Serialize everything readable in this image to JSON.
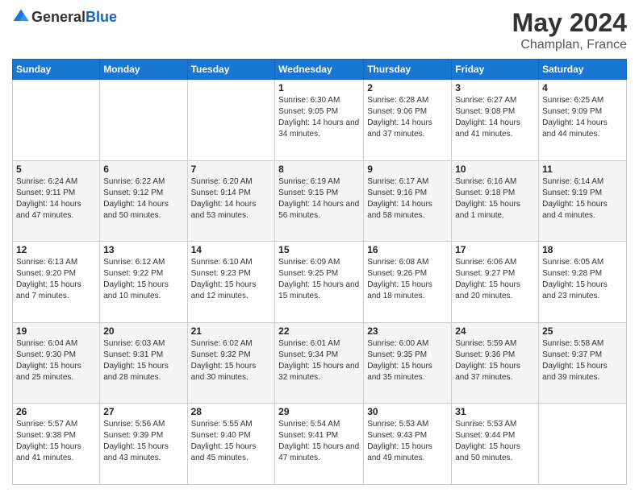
{
  "header": {
    "logo_general": "General",
    "logo_blue": "Blue",
    "month_year": "May 2024",
    "location": "Champlan, France"
  },
  "days_of_week": [
    "Sunday",
    "Monday",
    "Tuesday",
    "Wednesday",
    "Thursday",
    "Friday",
    "Saturday"
  ],
  "weeks": [
    [
      {
        "day": "",
        "sunrise": "",
        "sunset": "",
        "daylight": ""
      },
      {
        "day": "",
        "sunrise": "",
        "sunset": "",
        "daylight": ""
      },
      {
        "day": "",
        "sunrise": "",
        "sunset": "",
        "daylight": ""
      },
      {
        "day": "1",
        "sunrise": "Sunrise: 6:30 AM",
        "sunset": "Sunset: 9:05 PM",
        "daylight": "Daylight: 14 hours and 34 minutes."
      },
      {
        "day": "2",
        "sunrise": "Sunrise: 6:28 AM",
        "sunset": "Sunset: 9:06 PM",
        "daylight": "Daylight: 14 hours and 37 minutes."
      },
      {
        "day": "3",
        "sunrise": "Sunrise: 6:27 AM",
        "sunset": "Sunset: 9:08 PM",
        "daylight": "Daylight: 14 hours and 41 minutes."
      },
      {
        "day": "4",
        "sunrise": "Sunrise: 6:25 AM",
        "sunset": "Sunset: 9:09 PM",
        "daylight": "Daylight: 14 hours and 44 minutes."
      }
    ],
    [
      {
        "day": "5",
        "sunrise": "Sunrise: 6:24 AM",
        "sunset": "Sunset: 9:11 PM",
        "daylight": "Daylight: 14 hours and 47 minutes."
      },
      {
        "day": "6",
        "sunrise": "Sunrise: 6:22 AM",
        "sunset": "Sunset: 9:12 PM",
        "daylight": "Daylight: 14 hours and 50 minutes."
      },
      {
        "day": "7",
        "sunrise": "Sunrise: 6:20 AM",
        "sunset": "Sunset: 9:14 PM",
        "daylight": "Daylight: 14 hours and 53 minutes."
      },
      {
        "day": "8",
        "sunrise": "Sunrise: 6:19 AM",
        "sunset": "Sunset: 9:15 PM",
        "daylight": "Daylight: 14 hours and 56 minutes."
      },
      {
        "day": "9",
        "sunrise": "Sunrise: 6:17 AM",
        "sunset": "Sunset: 9:16 PM",
        "daylight": "Daylight: 14 hours and 58 minutes."
      },
      {
        "day": "10",
        "sunrise": "Sunrise: 6:16 AM",
        "sunset": "Sunset: 9:18 PM",
        "daylight": "Daylight: 15 hours and 1 minute."
      },
      {
        "day": "11",
        "sunrise": "Sunrise: 6:14 AM",
        "sunset": "Sunset: 9:19 PM",
        "daylight": "Daylight: 15 hours and 4 minutes."
      }
    ],
    [
      {
        "day": "12",
        "sunrise": "Sunrise: 6:13 AM",
        "sunset": "Sunset: 9:20 PM",
        "daylight": "Daylight: 15 hours and 7 minutes."
      },
      {
        "day": "13",
        "sunrise": "Sunrise: 6:12 AM",
        "sunset": "Sunset: 9:22 PM",
        "daylight": "Daylight: 15 hours and 10 minutes."
      },
      {
        "day": "14",
        "sunrise": "Sunrise: 6:10 AM",
        "sunset": "Sunset: 9:23 PM",
        "daylight": "Daylight: 15 hours and 12 minutes."
      },
      {
        "day": "15",
        "sunrise": "Sunrise: 6:09 AM",
        "sunset": "Sunset: 9:25 PM",
        "daylight": "Daylight: 15 hours and 15 minutes."
      },
      {
        "day": "16",
        "sunrise": "Sunrise: 6:08 AM",
        "sunset": "Sunset: 9:26 PM",
        "daylight": "Daylight: 15 hours and 18 minutes."
      },
      {
        "day": "17",
        "sunrise": "Sunrise: 6:06 AM",
        "sunset": "Sunset: 9:27 PM",
        "daylight": "Daylight: 15 hours and 20 minutes."
      },
      {
        "day": "18",
        "sunrise": "Sunrise: 6:05 AM",
        "sunset": "Sunset: 9:28 PM",
        "daylight": "Daylight: 15 hours and 23 minutes."
      }
    ],
    [
      {
        "day": "19",
        "sunrise": "Sunrise: 6:04 AM",
        "sunset": "Sunset: 9:30 PM",
        "daylight": "Daylight: 15 hours and 25 minutes."
      },
      {
        "day": "20",
        "sunrise": "Sunrise: 6:03 AM",
        "sunset": "Sunset: 9:31 PM",
        "daylight": "Daylight: 15 hours and 28 minutes."
      },
      {
        "day": "21",
        "sunrise": "Sunrise: 6:02 AM",
        "sunset": "Sunset: 9:32 PM",
        "daylight": "Daylight: 15 hours and 30 minutes."
      },
      {
        "day": "22",
        "sunrise": "Sunrise: 6:01 AM",
        "sunset": "Sunset: 9:34 PM",
        "daylight": "Daylight: 15 hours and 32 minutes."
      },
      {
        "day": "23",
        "sunrise": "Sunrise: 6:00 AM",
        "sunset": "Sunset: 9:35 PM",
        "daylight": "Daylight: 15 hours and 35 minutes."
      },
      {
        "day": "24",
        "sunrise": "Sunrise: 5:59 AM",
        "sunset": "Sunset: 9:36 PM",
        "daylight": "Daylight: 15 hours and 37 minutes."
      },
      {
        "day": "25",
        "sunrise": "Sunrise: 5:58 AM",
        "sunset": "Sunset: 9:37 PM",
        "daylight": "Daylight: 15 hours and 39 minutes."
      }
    ],
    [
      {
        "day": "26",
        "sunrise": "Sunrise: 5:57 AM",
        "sunset": "Sunset: 9:38 PM",
        "daylight": "Daylight: 15 hours and 41 minutes."
      },
      {
        "day": "27",
        "sunrise": "Sunrise: 5:56 AM",
        "sunset": "Sunset: 9:39 PM",
        "daylight": "Daylight: 15 hours and 43 minutes."
      },
      {
        "day": "28",
        "sunrise": "Sunrise: 5:55 AM",
        "sunset": "Sunset: 9:40 PM",
        "daylight": "Daylight: 15 hours and 45 minutes."
      },
      {
        "day": "29",
        "sunrise": "Sunrise: 5:54 AM",
        "sunset": "Sunset: 9:41 PM",
        "daylight": "Daylight: 15 hours and 47 minutes."
      },
      {
        "day": "30",
        "sunrise": "Sunrise: 5:53 AM",
        "sunset": "Sunset: 9:43 PM",
        "daylight": "Daylight: 15 hours and 49 minutes."
      },
      {
        "day": "31",
        "sunrise": "Sunrise: 5:53 AM",
        "sunset": "Sunset: 9:44 PM",
        "daylight": "Daylight: 15 hours and 50 minutes."
      },
      {
        "day": "",
        "sunrise": "",
        "sunset": "",
        "daylight": ""
      }
    ]
  ]
}
